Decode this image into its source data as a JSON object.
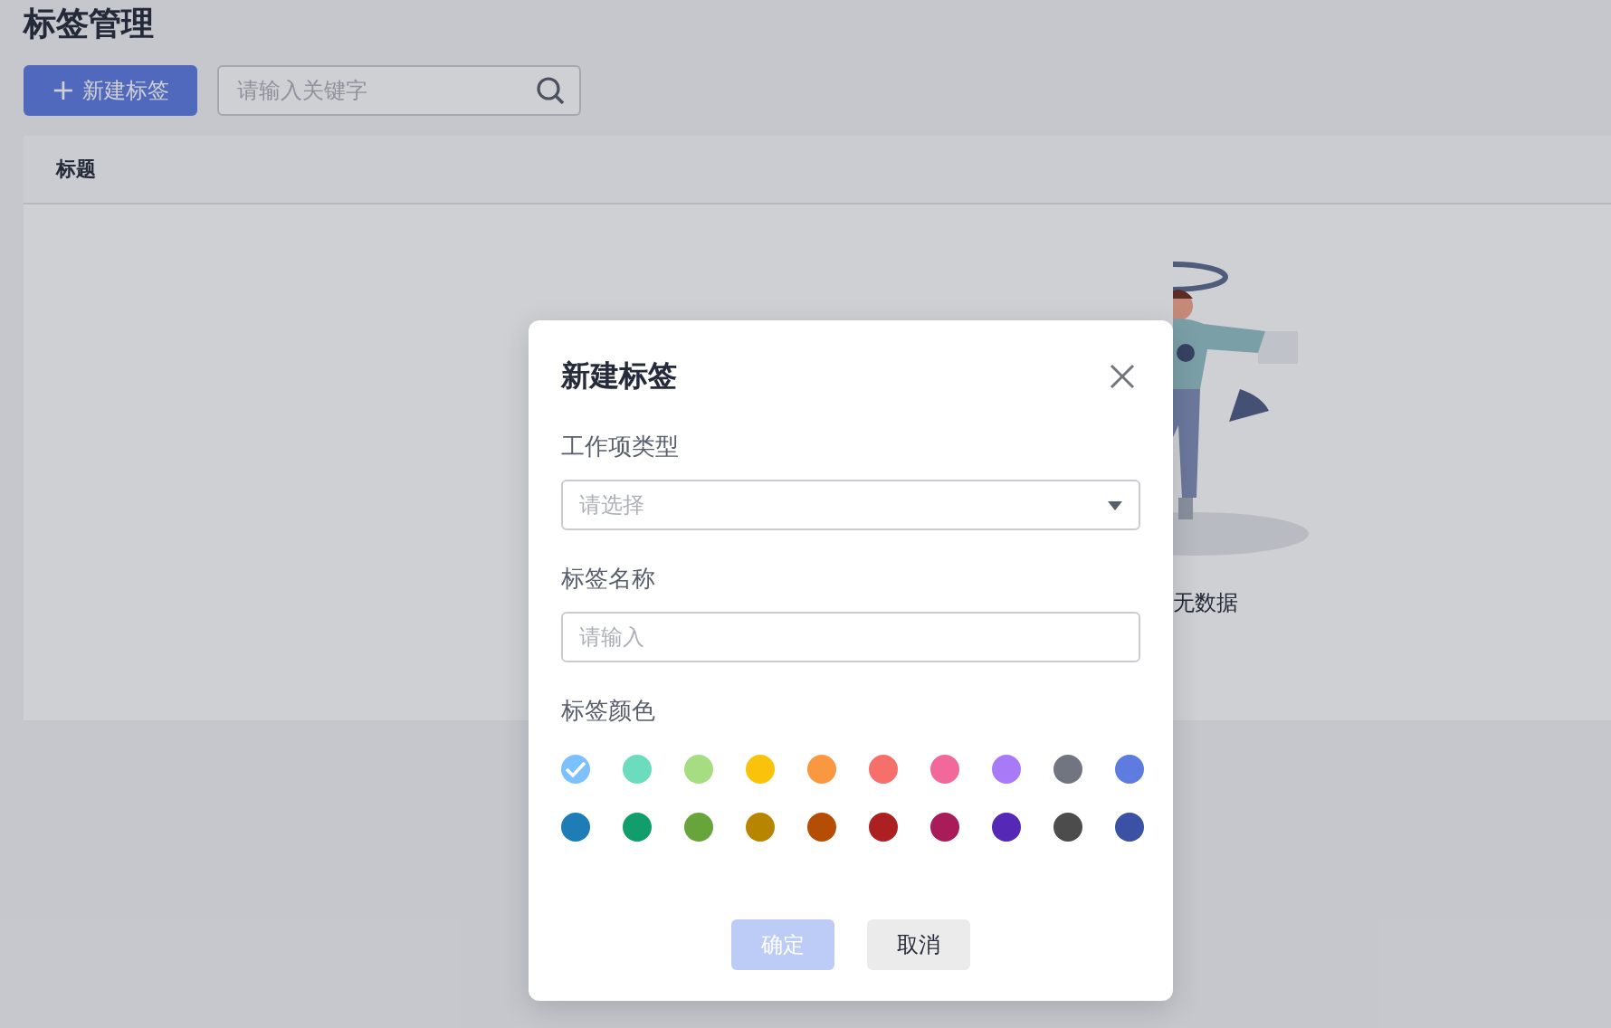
{
  "page": {
    "title": "标签管理"
  },
  "toolbar": {
    "new_button": {
      "icon": "+",
      "label": "新建标签"
    },
    "search": {
      "placeholder": "请输入关键字"
    }
  },
  "table": {
    "columns": [
      "标题"
    ],
    "empty_text": "无数据"
  },
  "dialog": {
    "title": "新建标签",
    "fields": [
      {
        "kind": "select",
        "label": "工作项类型",
        "placeholder": "请选择"
      },
      {
        "kind": "input",
        "label": "标签名称",
        "placeholder": "请输入"
      }
    ],
    "color_label": "标签颜色",
    "colors": [
      {
        "color": "#7cc1ff",
        "selected": true
      },
      {
        "color": "#6cdcbf",
        "selected": false
      },
      {
        "color": "#a6dd82",
        "selected": false
      },
      {
        "color": "#fac20a",
        "selected": false
      },
      {
        "color": "#fa9841",
        "selected": false
      },
      {
        "color": "#f66f6a",
        "selected": false
      },
      {
        "color": "#f3689a",
        "selected": false
      },
      {
        "color": "#a97af8",
        "selected": false
      },
      {
        "color": "#71757f",
        "selected": false
      },
      {
        "color": "#5e7ce0",
        "selected": false
      },
      {
        "color": "#1e7db7",
        "selected": false
      },
      {
        "color": "#129e6c",
        "selected": false
      },
      {
        "color": "#67a43a",
        "selected": false
      },
      {
        "color": "#b78500",
        "selected": false
      },
      {
        "color": "#b54e04",
        "selected": false
      },
      {
        "color": "#ad2021",
        "selected": false
      },
      {
        "color": "#a81c59",
        "selected": false
      },
      {
        "color": "#5628b6",
        "selected": false
      },
      {
        "color": "#4c4c4c",
        "selected": false
      },
      {
        "color": "#3b51a6",
        "selected": false
      }
    ],
    "buttons": [
      {
        "kind": "primary",
        "label": "确定",
        "disabled": true
      },
      {
        "kind": "secondary",
        "label": "取消",
        "disabled": false
      }
    ]
  }
}
